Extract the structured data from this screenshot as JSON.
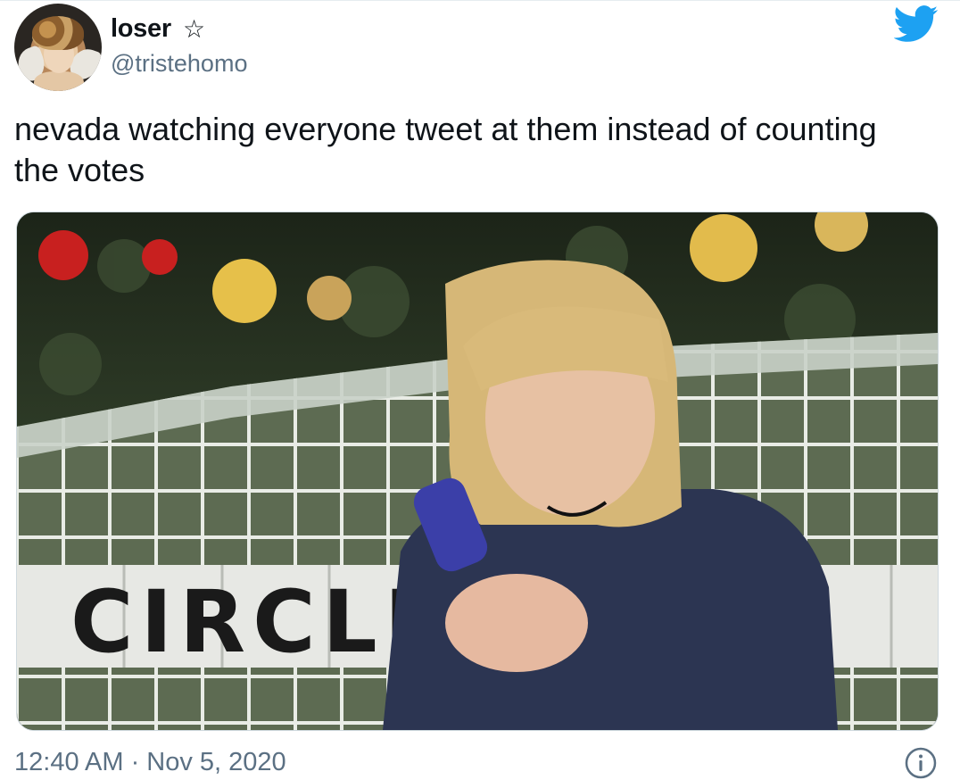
{
  "author": {
    "display_name": "loser",
    "badge_icon": "star-icon",
    "badge_glyph": "☆",
    "handle": "@tristehomo"
  },
  "platform": {
    "icon": "twitter-bird-icon",
    "color": "#1da1f2"
  },
  "tweet": {
    "text_line1": "nevada watching everyone tweet at them instead of counting",
    "text_line2": "the votes"
  },
  "media": {
    "icon": "video-still",
    "wall_letters": "CIRCLE"
  },
  "footer": {
    "timestamp": "12:40 AM · Nov 5, 2020",
    "info_icon": "info-icon"
  },
  "colors": {
    "text": "#0f1419",
    "secondary_text": "#5b7083",
    "twitter_blue": "#1da1f2"
  }
}
